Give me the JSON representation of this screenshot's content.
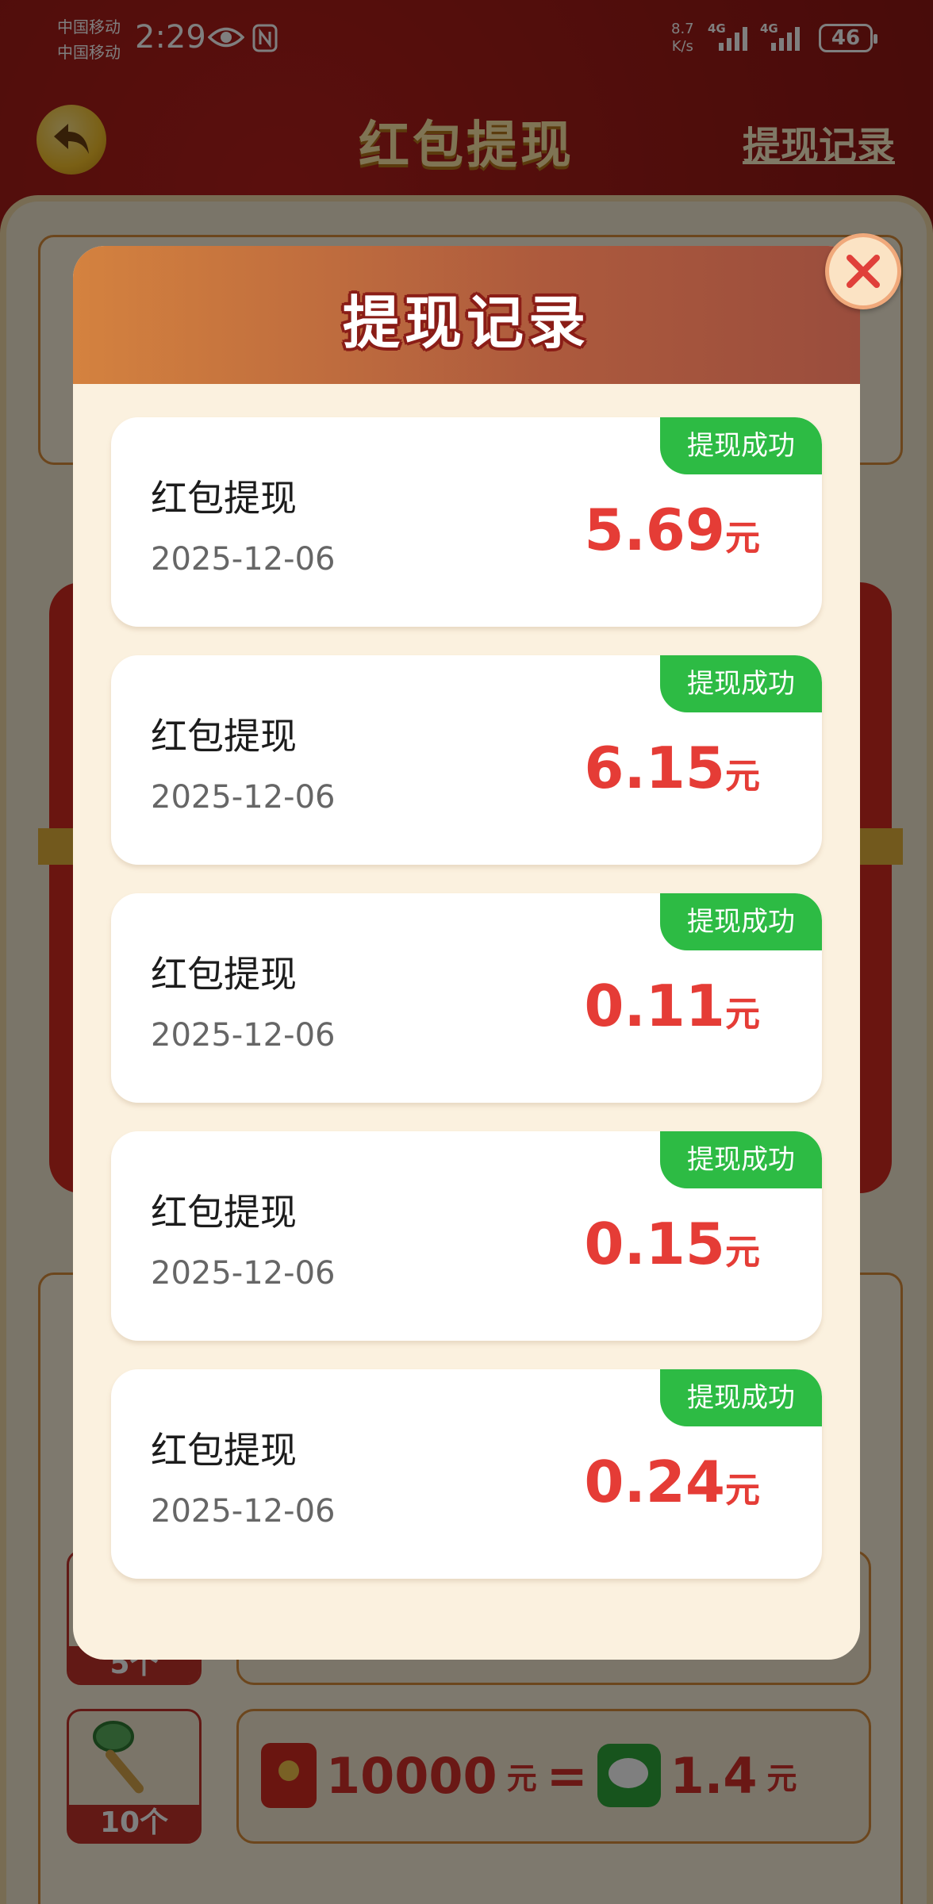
{
  "status_bar": {
    "carrier_1": "中国移动",
    "carrier_2": "中国移动",
    "time": "2:29",
    "net_speed_value": "8.7",
    "net_speed_unit": "K/s",
    "signal_1_label": "4G",
    "signal_2_label": "4G",
    "battery": "46"
  },
  "app": {
    "title": "红包提现",
    "records_link": "提现记录",
    "exchange_rows": [
      {
        "count": "5个",
        "left_amount": "",
        "right_amount": ""
      },
      {
        "count": "10个",
        "left_amount": "10000",
        "left_unit": "元",
        "equals": "=",
        "right_amount": "1.4",
        "right_unit": "元"
      }
    ]
  },
  "modal": {
    "title": "提现记录",
    "records": [
      {
        "title": "红包提现",
        "date": "2025-12-06",
        "amount": "5.69",
        "unit": "元",
        "status": "提现成功"
      },
      {
        "title": "红包提现",
        "date": "2025-12-06",
        "amount": "6.15",
        "unit": "元",
        "status": "提现成功"
      },
      {
        "title": "红包提现",
        "date": "2025-12-06",
        "amount": "0.11",
        "unit": "元",
        "status": "提现成功"
      },
      {
        "title": "红包提现",
        "date": "2025-12-06",
        "amount": "0.15",
        "unit": "元",
        "status": "提现成功"
      },
      {
        "title": "红包提现",
        "date": "2025-12-06",
        "amount": "0.24",
        "unit": "元",
        "status": "提现成功"
      }
    ]
  },
  "colors": {
    "status_success": "#2dbb44",
    "amount_red": "#e53c36",
    "modal_header_start": "#d4823f",
    "modal_header_end": "#9a4d3d"
  }
}
